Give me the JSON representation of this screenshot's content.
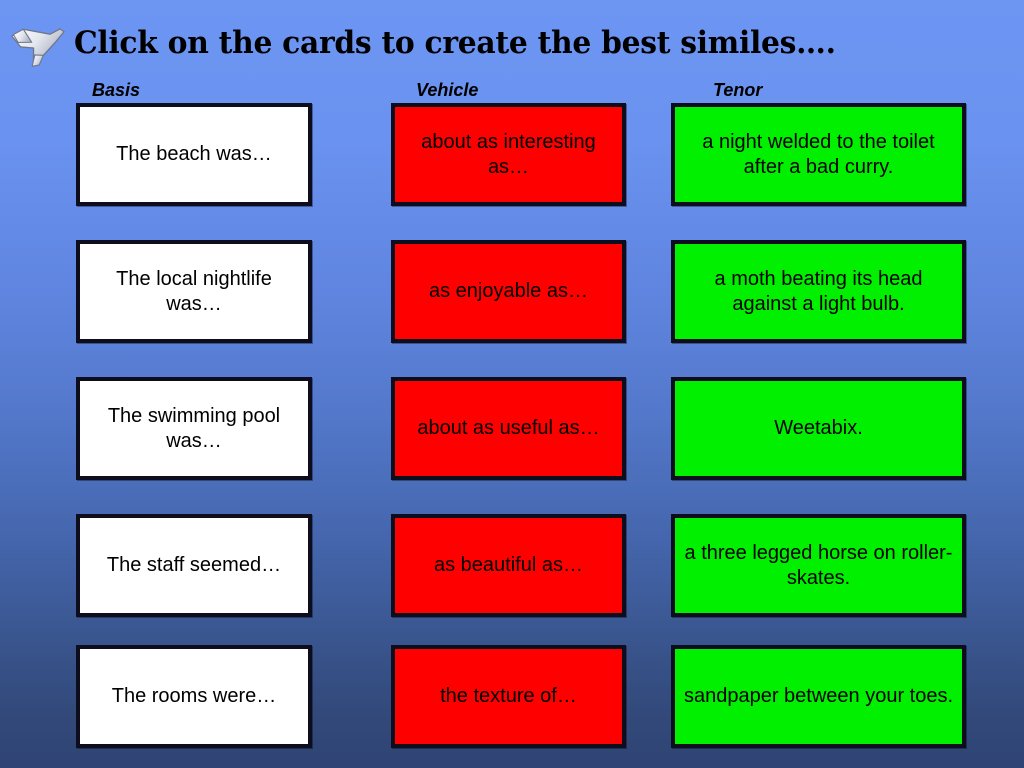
{
  "slide": {
    "title": "Click on the cards to create the best similes….",
    "plane_icon_name": "airplane-icon",
    "background_top_color": "#6d95f2",
    "background_bottom_color": "#2f4473"
  },
  "columns": [
    {
      "key": "basis",
      "label": "Basis",
      "card_color": "#ffffff"
    },
    {
      "key": "vehicle",
      "label": "Vehicle",
      "card_color": "#ff0000"
    },
    {
      "key": "tenor",
      "label": "Tenor",
      "card_color": "#00f000"
    }
  ],
  "cards": {
    "basis": [
      "The beach was…",
      "The local nightlife was…",
      "The swimming pool was…",
      "The staff seemed…",
      "The rooms were…"
    ],
    "vehicle": [
      "about as interesting as…",
      "as enjoyable as…",
      "about as useful as…",
      "as beautiful as…",
      "the texture of…"
    ],
    "tenor": [
      "a night welded to the toilet after a bad curry.",
      "a moth beating its head against a light bulb.",
      "Weetabix.",
      "a three legged horse on roller-skates.",
      "sandpaper between your toes."
    ]
  }
}
